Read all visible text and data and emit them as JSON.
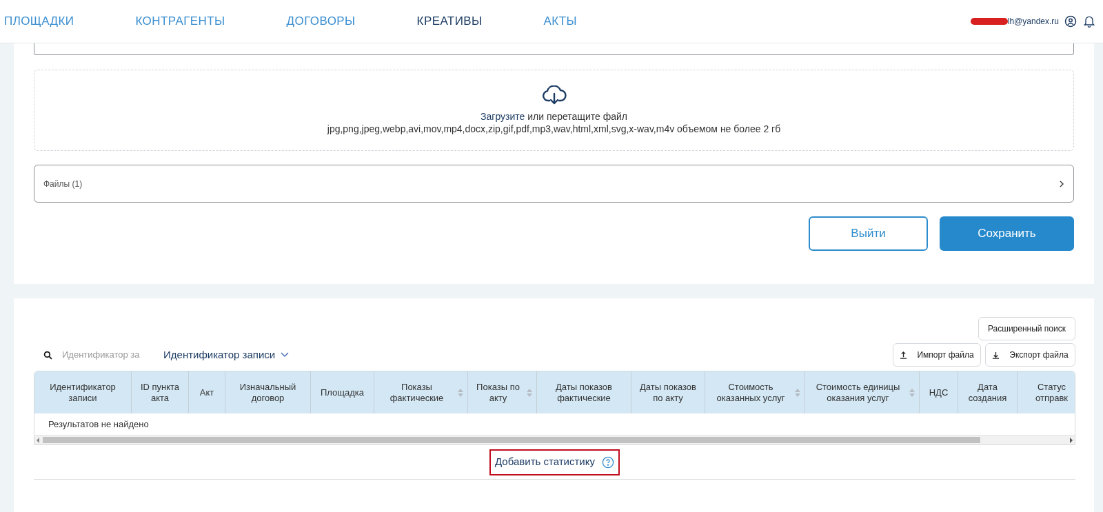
{
  "nav": {
    "items": [
      {
        "label": "ПЛОЩАДКИ",
        "selected": false
      },
      {
        "label": "КОНТРАГЕНТЫ",
        "selected": false
      },
      {
        "label": "ДОГОВОРЫ",
        "selected": false
      },
      {
        "label": "КРЕАТИВЫ",
        "selected": true
      },
      {
        "label": "АКТЫ",
        "selected": false
      }
    ],
    "user_email": "lh@yandex.ru"
  },
  "upload": {
    "link": "Загрузите",
    "text": " или перетащите файл",
    "formats": "jpg,png,jpeg,webp,avi,mov,mp4,docx,zip,gif,pdf,mp3,wav,html,xml,svg,x-wav,m4v объемом не более 2 гб"
  },
  "files": {
    "label": "Файлы (1)",
    "expanded": false
  },
  "buttons": {
    "exit": "Выйти",
    "save": "Сохранить"
  },
  "table_section": {
    "advanced_search": "Расширенный поиск",
    "search_placeholder": "Идентификатор за",
    "search_field_select": "Идентификатор записи",
    "import": "Импорт файла",
    "export": "Экспорт файла",
    "columns": [
      {
        "label": "Идентификатор записи",
        "sortable": false
      },
      {
        "label": "ID пункта акта",
        "sortable": false
      },
      {
        "label": "Акт",
        "sortable": false
      },
      {
        "label": "Изначальный договор",
        "sortable": false
      },
      {
        "label": "Площадка",
        "sortable": false
      },
      {
        "label": "Показы фактические",
        "sortable": true
      },
      {
        "label": "Показы по акту",
        "sortable": true
      },
      {
        "label": "Даты показов фактические",
        "sortable": false
      },
      {
        "label": "Даты показов по акту",
        "sortable": false
      },
      {
        "label": "Стоимость оказанных услуг",
        "sortable": true
      },
      {
        "label": "Стоимость единицы оказания услуг",
        "sortable": true
      },
      {
        "label": "НДС",
        "sortable": false
      },
      {
        "label": "Дата создания",
        "sortable": false
      },
      {
        "label": "Статус отправк",
        "sortable": false
      }
    ],
    "empty_message": "Результатов не найдено",
    "add_statistics": "Добавить статистику"
  }
}
